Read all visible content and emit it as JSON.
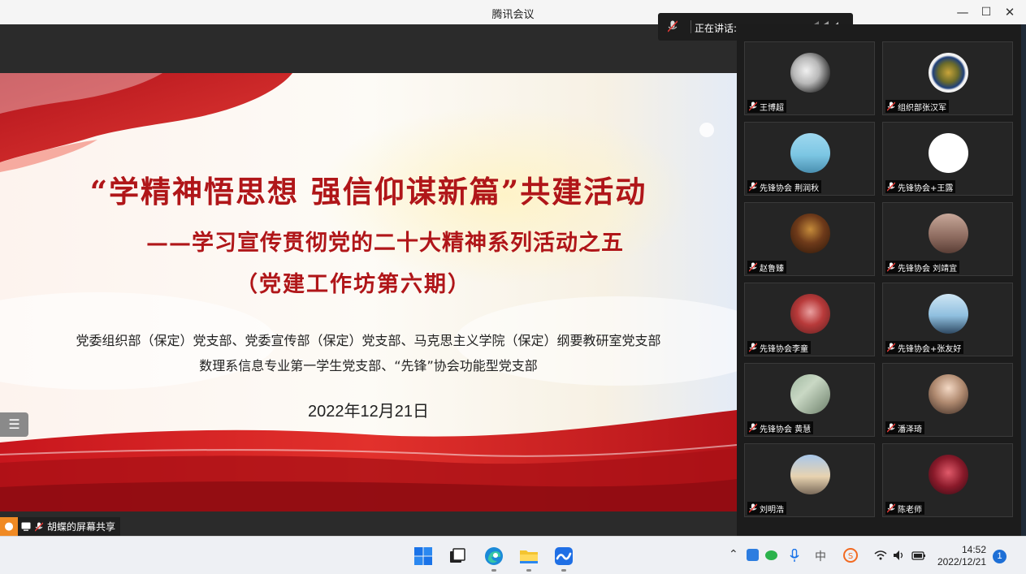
{
  "window": {
    "title": "腾讯会议",
    "minimize": "—",
    "maximize": "☐",
    "close": "✕"
  },
  "speaking": {
    "label": "正在讲话:"
  },
  "slide": {
    "title": "“学精神悟思想  强信仰谋新篇”共建活动",
    "subtitle1": "——学习宣传贯彻党的二十大精神系列活动之五",
    "subtitle2": "（党建工作坊第六期）",
    "org_line1": "党委组织部（保定）党支部、党委宣传部（保定）党支部、马克思主义学院（保定）纲要教研室党支部",
    "org_line2": "数理系信息专业第一学生党支部、“先锋”协会功能型党支部",
    "date": "2022年12月21日"
  },
  "menu_button": {
    "icon": "☰"
  },
  "screen_share": {
    "label": "胡蝶的屏幕共享"
  },
  "participants": [
    {
      "name": "王博超"
    },
    {
      "name": "组织部张汉军"
    },
    {
      "name": "先锋协会 荆润秋"
    },
    {
      "name": "先锋协会+王露"
    },
    {
      "name": "赵鲁臻"
    },
    {
      "name": "先锋协会 刘靖宜"
    },
    {
      "name": "先锋协会李童"
    },
    {
      "name": "先锋协会+张友好"
    },
    {
      "name": "先锋协会 黄慧"
    },
    {
      "name": "潘泽琦"
    },
    {
      "name": "刘明浩"
    },
    {
      "name": "陈老师"
    }
  ],
  "taskbar": {
    "clock_time": "14:52",
    "clock_date": "2022/12/21",
    "notification_count": "1",
    "ime_label": "中"
  }
}
